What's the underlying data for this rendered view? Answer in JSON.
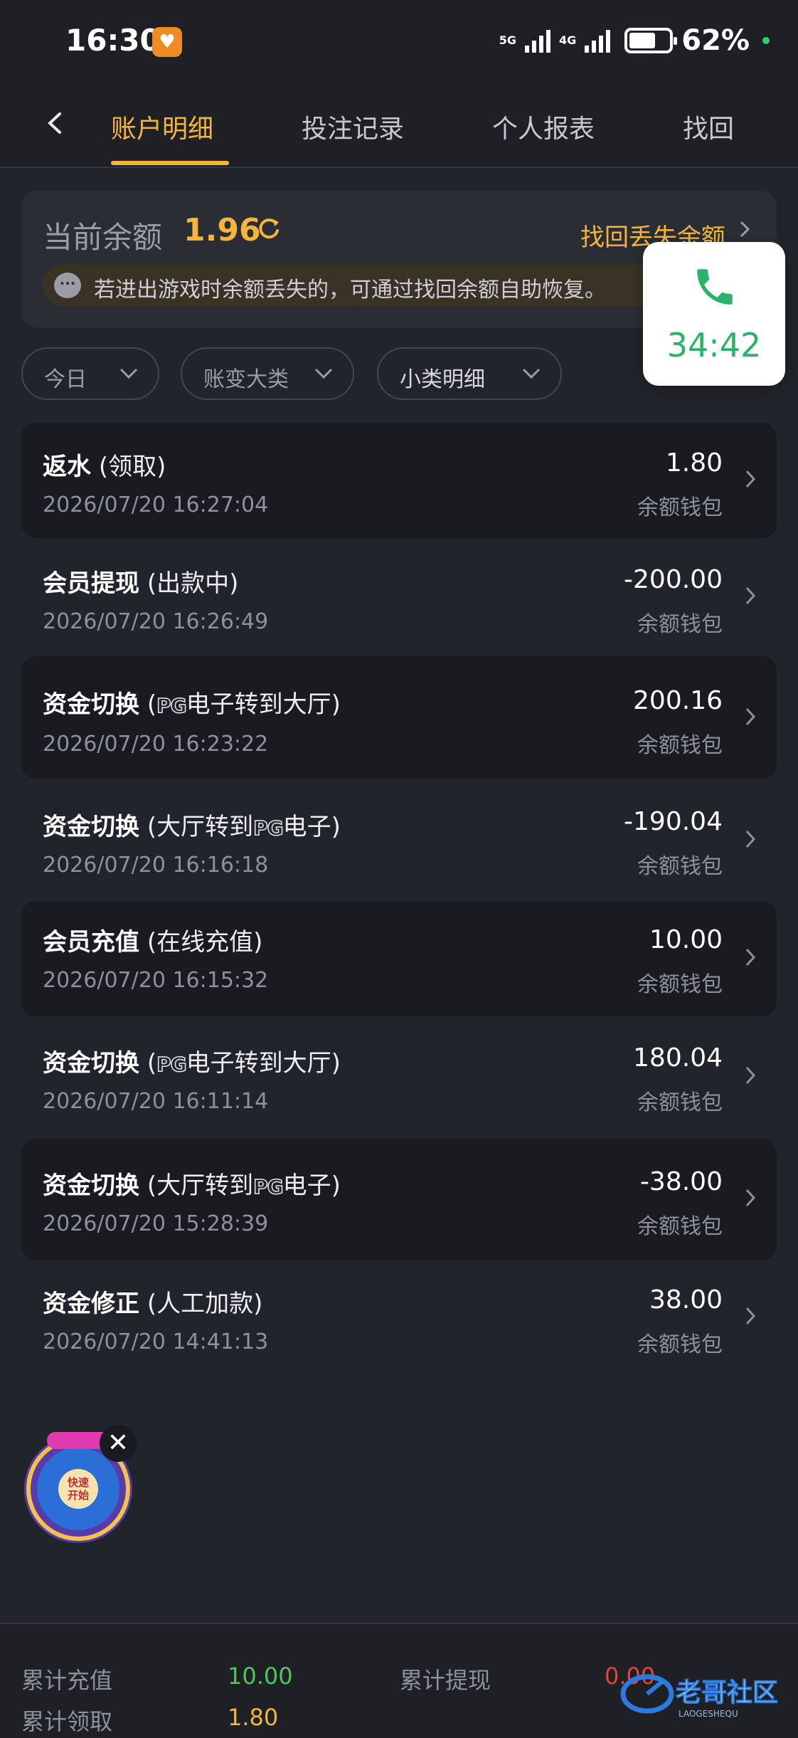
{
  "status_bar": {
    "time": "16:30",
    "net_5g": "5G",
    "net_4g": "4G",
    "battery": "62%"
  },
  "nav": {
    "tabs": [
      "账户明细",
      "投注记录",
      "个人报表",
      "找回"
    ]
  },
  "balance": {
    "label": "当前余额",
    "amount": "1.96",
    "recover_link": "找回丢失余额",
    "notice": "若进出游戏时余额丢失的，可通过找回余额自助恢复。"
  },
  "call": {
    "duration": "34:42"
  },
  "filters": [
    "今日",
    "账变大类",
    "小类明细"
  ],
  "transactions": [
    {
      "title": "返水",
      "detail": "(领取)",
      "time": "2026/07/20 16:27:04",
      "amount": "1.80",
      "wallet": "余额钱包"
    },
    {
      "title": "会员提现",
      "detail": "(出款中)",
      "time": "2026/07/20 16:26:49",
      "amount": "-200.00",
      "wallet": "余额钱包"
    },
    {
      "title": "资金切换",
      "detail_pre": "(",
      "detail_pg": "PG",
      "detail_post": "电子转到大厅)",
      "time": "2026/07/20 16:23:22",
      "amount": "200.16",
      "wallet": "余额钱包"
    },
    {
      "title": "资金切换",
      "detail_pre": "(大厅转到",
      "detail_pg": "PG",
      "detail_post": "电子)",
      "time": "2026/07/20 16:16:18",
      "amount": "-190.04",
      "wallet": "余额钱包"
    },
    {
      "title": "会员充值",
      "detail": "(在线充值)",
      "time": "2026/07/20 16:15:32",
      "amount": "10.00",
      "wallet": "余额钱包"
    },
    {
      "title": "资金切换",
      "detail_pre": "(",
      "detail_pg": "PG",
      "detail_post": "电子转到大厅)",
      "time": "2026/07/20 16:11:14",
      "amount": "180.04",
      "wallet": "余额钱包"
    },
    {
      "title": "资金切换",
      "detail_pre": "(大厅转到",
      "detail_pg": "PG",
      "detail_post": "电子)",
      "time": "2026/07/20 15:28:39",
      "amount": "-38.00",
      "wallet": "余额钱包"
    },
    {
      "title": "资金修正",
      "detail": "(人工加款)",
      "time": "2026/07/20 14:41:13",
      "amount": "38.00",
      "wallet": "余额钱包"
    }
  ],
  "game_badge": {
    "label": "快速开始"
  },
  "footer": {
    "total_deposit_label": "累计充值",
    "total_deposit": "10.00",
    "total_withdraw_label": "累计提现",
    "total_withdraw": "0.00",
    "total_claim_label": "累计领取",
    "total_claim": "1.80"
  },
  "watermark": {
    "text": "老哥社区",
    "sub": "LAOGESHEQU"
  },
  "colors": {
    "accent": "#f5b53b",
    "positive": "#4cc75a",
    "negative": "#e0443a",
    "call_green": "#2bb36a"
  }
}
